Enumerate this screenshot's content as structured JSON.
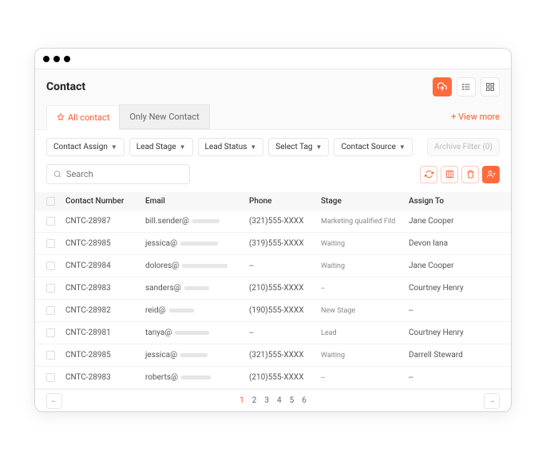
{
  "header": {
    "title": "Contact"
  },
  "tabs": {
    "all": "All contact",
    "new": "Only New Contact",
    "view_more": "+  View more"
  },
  "filters": {
    "assign": "Contact Assign",
    "stage": "Lead Stage",
    "status": "Lead Status",
    "tag": "Select Tag",
    "source": "Contact Source",
    "archive": "Archive Filter (0)"
  },
  "search": {
    "placeholder": "Search"
  },
  "columns": {
    "number": "Contact Number",
    "email": "Email",
    "phone": "Phone",
    "stage": "Stage",
    "assign": "Assign To"
  },
  "rows": [
    {
      "num": "CNTC-28987",
      "email": "bill.sender@",
      "phone": "(321)555-XXXX",
      "stage": "Marketing qualified Fild",
      "assign": "Jane Cooper"
    },
    {
      "num": "CNTC-28985",
      "email": "jessica@",
      "phone": "(319)555-XXXX",
      "stage": "Waiting",
      "assign": "Devon lana"
    },
    {
      "num": "CNTC-28984",
      "email": "dolores@",
      "phone": "--",
      "stage": "Waiting",
      "assign": "Jane Cooper"
    },
    {
      "num": "CNTC-28983",
      "email": "sanders@",
      "phone": "(210)555-XXXX",
      "stage": "--",
      "assign": "Courtney Henry"
    },
    {
      "num": "CNTC-28982",
      "email": "reid@",
      "phone": "(190)555-XXXX",
      "stage": "New Stage",
      "assign": "--"
    },
    {
      "num": "CNTC-28981",
      "email": "tanya@",
      "phone": "--",
      "stage": "Lead",
      "assign": "Courtney Henry"
    },
    {
      "num": "CNTC-28985",
      "email": "jessica@",
      "phone": "(321)555-XXXX",
      "stage": "Waiting",
      "assign": "Darrell Steward"
    },
    {
      "num": "CNTC-28983",
      "email": "roberts@",
      "phone": "(210)555-XXXX",
      "stage": "--",
      "assign": "--"
    }
  ],
  "pagination": {
    "pages": [
      "1",
      "2",
      "3",
      "4",
      "5",
      "6"
    ],
    "active": 0
  }
}
